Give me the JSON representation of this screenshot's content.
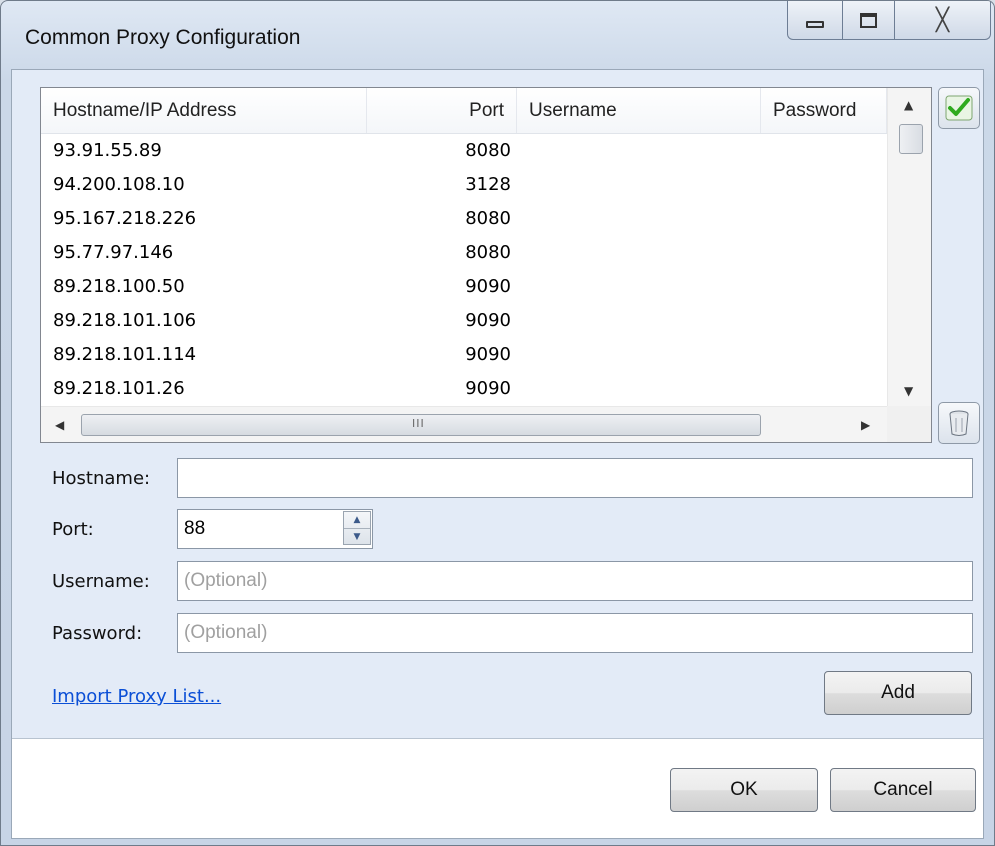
{
  "window": {
    "title": "Common Proxy Configuration",
    "controls": {
      "minimize": "minimize",
      "maximize": "maximize",
      "close": "╳"
    }
  },
  "proxy_list": {
    "columns": {
      "hostname": "Hostname/IP Address",
      "port": "Port",
      "username": "Username",
      "password": "Password"
    },
    "rows": [
      {
        "hostname": "93.91.55.89",
        "port": "8080",
        "username": "",
        "password": ""
      },
      {
        "hostname": "94.200.108.10",
        "port": "3128",
        "username": "",
        "password": ""
      },
      {
        "hostname": "95.167.218.226",
        "port": "8080",
        "username": "",
        "password": ""
      },
      {
        "hostname": "95.77.97.146",
        "port": "8080",
        "username": "",
        "password": ""
      },
      {
        "hostname": "89.218.100.50",
        "port": "9090",
        "username": "",
        "password": ""
      },
      {
        "hostname": "89.218.101.106",
        "port": "9090",
        "username": "",
        "password": ""
      },
      {
        "hostname": "89.218.101.114",
        "port": "9090",
        "username": "",
        "password": ""
      },
      {
        "hostname": "89.218.101.26",
        "port": "9090",
        "username": "",
        "password": ""
      }
    ],
    "scroll_grip": "III"
  },
  "form": {
    "hostname_label": "Hostname:",
    "hostname_value": "",
    "port_label": "Port:",
    "port_value": "88",
    "username_label": "Username:",
    "username_placeholder": "(Optional)",
    "password_label": "Password:",
    "password_placeholder": "(Optional)"
  },
  "import_link": "Import Proxy List...",
  "buttons": {
    "add": "Add",
    "ok": "OK",
    "cancel": "Cancel"
  },
  "icons": {
    "apply": "check-icon",
    "delete": "trash-icon"
  },
  "colors": {
    "check_green": "#2faa1e",
    "link_blue": "#0b4fd6"
  }
}
